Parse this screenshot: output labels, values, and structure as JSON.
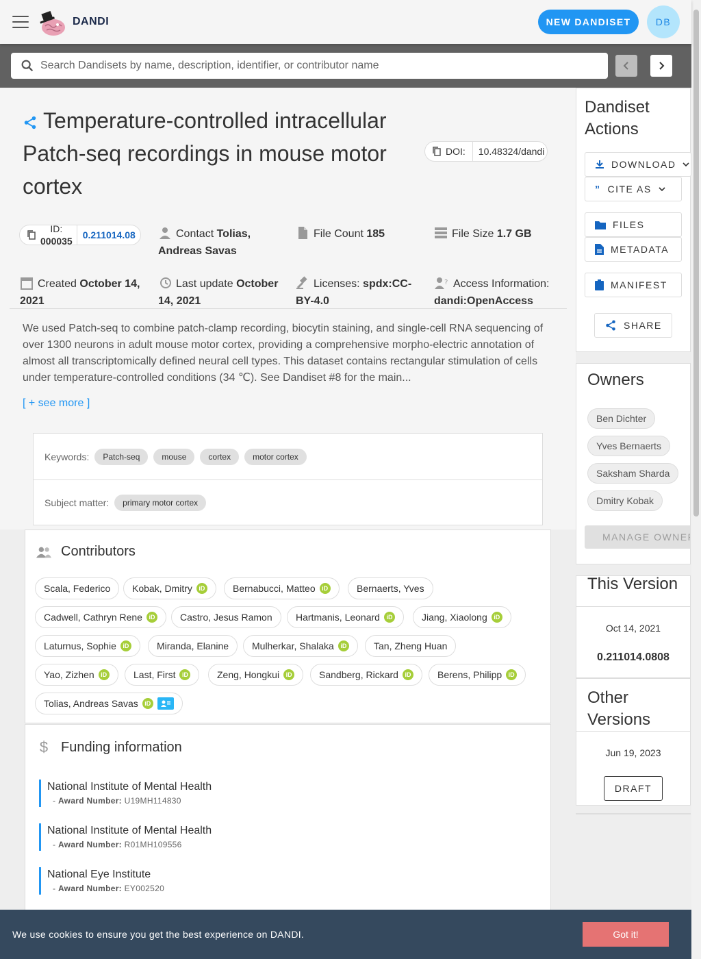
{
  "app": {
    "brand": "DANDI",
    "new_dandiset": "NEW DANDISET",
    "avatar_initials": "DB"
  },
  "search": {
    "placeholder": "Search Dandisets by name, description, identifier, or contributor name"
  },
  "dandiset": {
    "title": "Temperature-controlled intracellular Patch-seq recordings in mouse motor cortex",
    "doi_label": "DOI:",
    "doi_value": "10.48324/dandi",
    "id_label": "ID:",
    "id_value": "000035",
    "version": "0.211014.08",
    "contact_label": "Contact",
    "contact_name": "Tolias, Andreas Savas",
    "file_count_label": "File Count",
    "file_count": "185",
    "file_size_label": "File Size",
    "file_size": "1.7 GB",
    "created_label": "Created",
    "created": "October 14, 2021",
    "last_update_label": "Last update",
    "last_update": "October 14, 2021",
    "licenses_label": "Licenses:",
    "license": "spdx:CC-BY-4.0",
    "access_label": "Access Information:",
    "access": "dandi:OpenAccess",
    "description": "We used Patch-seq to combine patch-clamp recording, biocytin staining, and single-cell RNA sequencing of over 1300 neurons in adult mouse motor cortex, providing a comprehensive morpho-electric annotation of almost all transcriptomically defined neural cell types. This dataset contains rectangular stimulation of cells under temperature-controlled conditions (34 ℃). See Dandiset #8 for the main...",
    "see_more": "[ + see more ]",
    "keywords_label": "Keywords:",
    "keywords": [
      "Patch-seq",
      "mouse",
      "cortex",
      "motor cortex"
    ],
    "subject_label": "Subject matter:",
    "subject": "primary motor cortex"
  },
  "contributors": {
    "title": "Contributors",
    "people": [
      {
        "name": "Scala, Federico",
        "orcid": false
      },
      {
        "name": "Kobak, Dmitry",
        "orcid": true
      },
      {
        "name": "Bernabucci, Matteo",
        "orcid": true
      },
      {
        "name": "Bernaerts, Yves",
        "orcid": false
      },
      {
        "name": "Cadwell, Cathryn Rene",
        "orcid": true
      },
      {
        "name": "Castro, Jesus Ramon",
        "orcid": false
      },
      {
        "name": "Hartmanis, Leonard",
        "orcid": true
      },
      {
        "name": "Jiang, Xiaolong",
        "orcid": true
      },
      {
        "name": "Laturnus, Sophie",
        "orcid": true
      },
      {
        "name": "Miranda, Elanine",
        "orcid": false
      },
      {
        "name": "Mulherkar, Shalaka",
        "orcid": true
      },
      {
        "name": "Tan, Zheng Huan",
        "orcid": false
      },
      {
        "name": "Yao, Zizhen",
        "orcid": true
      },
      {
        "name": "Last, First",
        "orcid": true
      },
      {
        "name": "Zeng, Hongkui",
        "orcid": true
      },
      {
        "name": "Sandberg, Rickard",
        "orcid": true
      },
      {
        "name": "Berens, Philipp",
        "orcid": true
      },
      {
        "name": "Tolias, Andreas Savas",
        "orcid": true,
        "contact": true
      }
    ]
  },
  "funding": {
    "title": "Funding information",
    "award_label": "Award Number:",
    "items": [
      {
        "name": "National Institute of Mental Health",
        "award": "U19MH114830"
      },
      {
        "name": "National Institute of Mental Health",
        "award": "R01MH109556"
      },
      {
        "name": "National Eye Institute",
        "award": "EY002520"
      }
    ]
  },
  "sidebar": {
    "actions_title": "Dandiset Actions",
    "download": "DOWNLOAD",
    "cite_as": "CITE AS",
    "files": "FILES",
    "metadata": "METADATA",
    "manifest": "MANIFEST",
    "share": "SHARE",
    "owners_title": "Owners",
    "owners": [
      "Ben Dichter",
      "Yves Bernaerts",
      "Saksham Sharda",
      "Dmitry Kobak"
    ],
    "manage_owners": "MANAGE OWNERS",
    "this_version_title": "This Version",
    "this_version_date": "Oct 14, 2021",
    "this_version_id": "0.211014.0808",
    "other_versions_title": "Other Versions",
    "other_version_date": "Jun 19, 2023",
    "draft": "DRAFT"
  },
  "cookie": {
    "text": "We use cookies to ensure you get the best experience on DANDI.",
    "button": "Got it!"
  },
  "colors": {
    "primary": "#2196f3",
    "orcid": "#a6ce39",
    "cookie_bg": "#35495e",
    "cookie_btn": "#e57373"
  }
}
